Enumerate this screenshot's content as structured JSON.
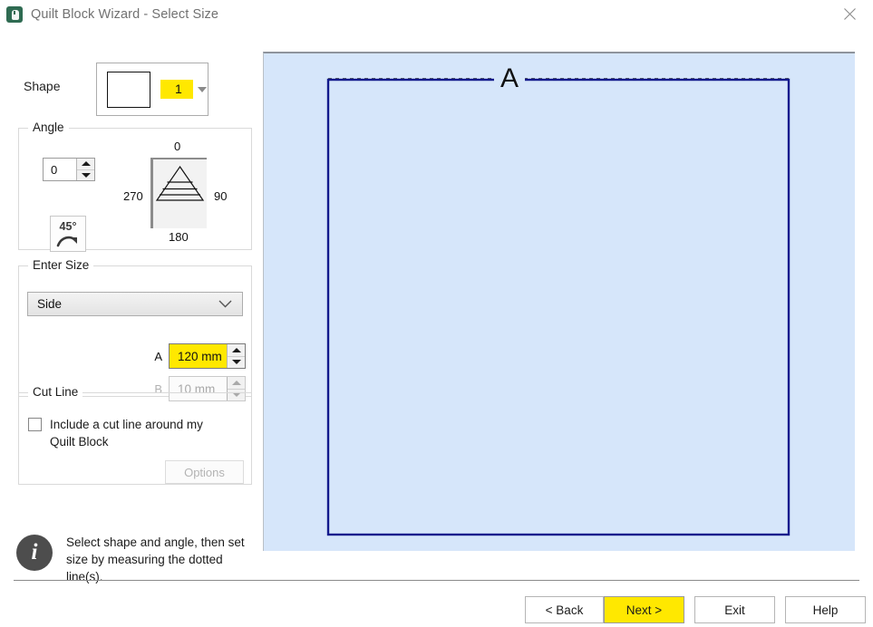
{
  "window": {
    "title": "Quilt Block Wizard - Select Size",
    "icon": "quilt-block-app-icon",
    "close_icon": "close-icon"
  },
  "shape": {
    "label": "Shape",
    "glyph": "square-shape-icon",
    "number": "1",
    "caret_icon": "chevron-down-icon"
  },
  "angle": {
    "legend": "Angle",
    "value": "0",
    "rotate_button_label": "45°",
    "rotate_button_icon": "rotate-clockwise-icon",
    "dial": {
      "top": "0",
      "right": "90",
      "bottom": "180",
      "left": "270",
      "preview_icon": "pyramid-triangle-preview"
    }
  },
  "enter_size": {
    "legend": "Enter Size",
    "mode_select": {
      "value": "Side",
      "chevron_icon": "chevron-down-icon"
    },
    "field_a": {
      "letter": "A",
      "value": "120 mm",
      "highlighted": true,
      "enabled": true
    },
    "field_b": {
      "letter": "B",
      "value": "10 mm",
      "highlighted": false,
      "enabled": false
    }
  },
  "cut_line": {
    "legend": "Cut Line",
    "checkbox_label": "Include a cut line around my Quilt Block",
    "checked": false,
    "options_label": "Options",
    "options_enabled": false
  },
  "hint": {
    "icon": "info-icon",
    "text": "Select shape and angle, then set size by measuring the dotted line(s)."
  },
  "preview": {
    "measure_label": "A",
    "background_color": "#d6e6fa",
    "shape_stroke_color": "#131a8c",
    "dotted_line_color": "#1a1a1a"
  },
  "footer": {
    "back_label": "< Back",
    "next_label": "Next >",
    "exit_label": "Exit",
    "help_label": "Help"
  }
}
